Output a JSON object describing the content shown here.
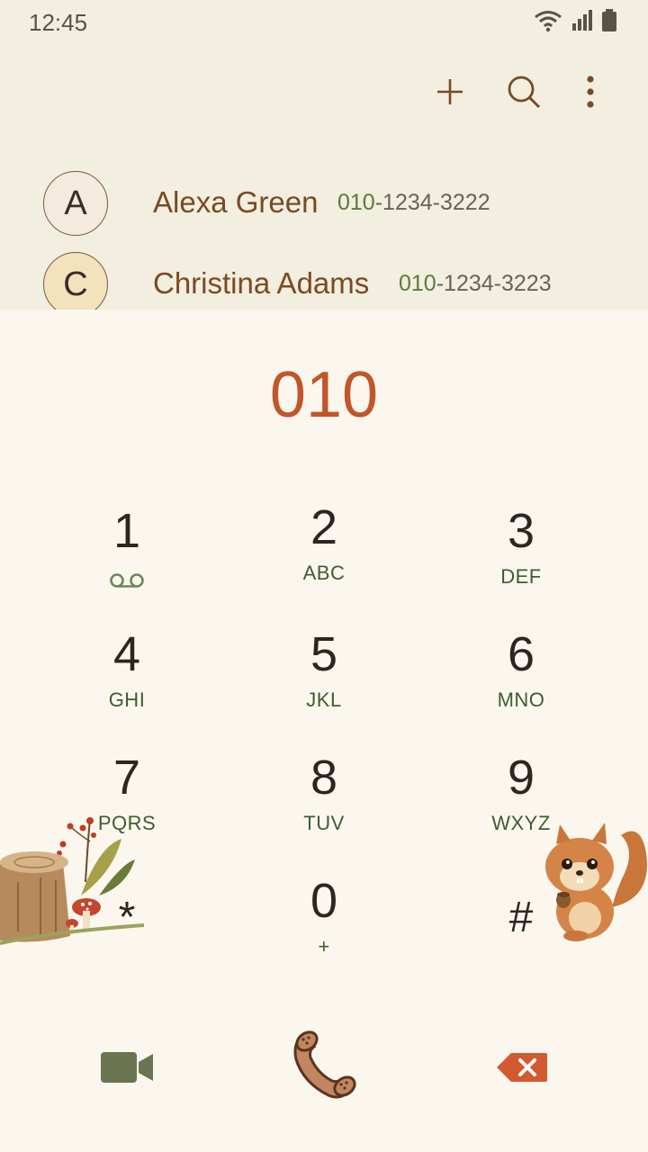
{
  "status_bar": {
    "time": "12:45"
  },
  "icons": {
    "wifi": "wifi-icon",
    "signal": "signal-icon",
    "battery": "battery-icon",
    "add": "plus-icon",
    "search": "search-icon",
    "more": "more-vert-icon",
    "voicemail": "voicemail-icon",
    "video": "video-call-icon",
    "call": "phone-call-icon",
    "backspace": "backspace-icon"
  },
  "contacts": [
    {
      "initial": "A",
      "name": "Alexa Green",
      "number_match": "010",
      "number_rest": "-1234-3222"
    },
    {
      "initial": "C",
      "name": "Christina Adams",
      "number_match": "010",
      "number_rest": "-1234-3223"
    }
  ],
  "dial_input": "010",
  "keypad": [
    {
      "digit": "1",
      "letters": ""
    },
    {
      "digit": "2",
      "letters": "ABC"
    },
    {
      "digit": "3",
      "letters": "DEF"
    },
    {
      "digit": "4",
      "letters": "GHI"
    },
    {
      "digit": "5",
      "letters": "JKL"
    },
    {
      "digit": "6",
      "letters": "MNO"
    },
    {
      "digit": "7",
      "letters": "PQRS"
    },
    {
      "digit": "8",
      "letters": "TUV"
    },
    {
      "digit": "9",
      "letters": "WXYZ"
    },
    {
      "digit": "*",
      "letters": ""
    },
    {
      "digit": "0",
      "letters": "+"
    },
    {
      "digit": "#",
      "letters": ""
    }
  ],
  "colors": {
    "header_bg": "#F2EEE0",
    "dialpad_bg": "#FBF7EE",
    "accent_orange": "#C0562A",
    "name_brown": "#7a4a22",
    "letters_green": "#3f5c2e",
    "video_green": "#6b7450"
  }
}
